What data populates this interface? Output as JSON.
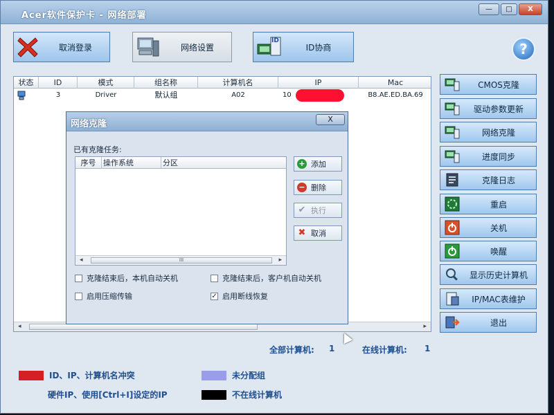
{
  "window": {
    "title": "Acer软件保护卡 - 网络部署",
    "controls": [
      "—",
      "□",
      "X"
    ]
  },
  "toolbar": {
    "logout_label": "取消登录",
    "network_settings_label": "网络设置",
    "id_negotiation_label": "ID协商",
    "id_icon_text": "ID",
    "help_label": "?"
  },
  "computer_table": {
    "columns": [
      "状态",
      "ID",
      "模式",
      "组名称",
      "计算机名",
      "IP",
      "Mac"
    ],
    "rows": [
      {
        "id": "3",
        "mode": "Driver",
        "group": "默认组",
        "name": "A02",
        "ip_prefix": "10",
        "mac": "B8.AE.ED.BA.69"
      }
    ]
  },
  "sidebar": {
    "items": [
      {
        "label": "CMOS克隆",
        "icon": "computer-icon"
      },
      {
        "label": "驱动参数更新",
        "icon": "computer-icon"
      },
      {
        "label": "网络克隆",
        "icon": "computer-icon"
      },
      {
        "label": "进度同步",
        "icon": "computer-icon"
      },
      {
        "label": "克隆日志",
        "icon": "log-icon"
      },
      {
        "label": "重启",
        "icon": "restart-icon"
      },
      {
        "label": "关机",
        "icon": "shutdown-icon"
      },
      {
        "label": "唤醒",
        "icon": "wake-icon"
      },
      {
        "label": "显示历史计算机",
        "icon": "history-icon"
      },
      {
        "label": "IP/MAC表维护",
        "icon": "ip-table-icon"
      },
      {
        "label": "退出",
        "icon": "exit-icon"
      }
    ]
  },
  "clone_dialog": {
    "title": "网络克隆",
    "close_label": "X",
    "tasks_label": "已有克隆任务:",
    "columns": [
      "序号",
      "操作系统",
      "分区"
    ],
    "scroll_thumb": "III",
    "buttons": {
      "add": "添加",
      "delete": "删除",
      "execute": "执行",
      "cancel": "取消"
    },
    "options": {
      "shutdown_local": "克隆结束后，本机自动关机",
      "shutdown_client": "克隆结束后，客户机自动关机",
      "compression": "启用压缩传输",
      "resume": "启用断线恢复"
    }
  },
  "stats": {
    "all_label": "全部计算机:",
    "all_count": "1",
    "online_label": "在线计算机:",
    "online_count": "1"
  },
  "legend": {
    "conflict": "ID、IP、计算机名冲突",
    "unassigned": "未分配组",
    "hardware_ip": "硬件IP、使用[Ctrl+I]设定的IP",
    "offline": "不在线计算机"
  },
  "colors": {
    "conflict": "#d42025",
    "unassigned": "#9a9ee8",
    "offline": "#000000",
    "accent": "#1f4f8f"
  }
}
